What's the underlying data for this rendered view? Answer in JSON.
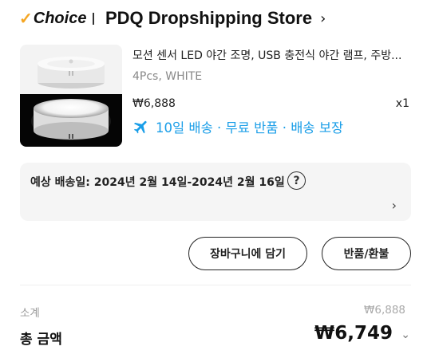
{
  "header": {
    "choice_label": "Choice",
    "store_name": "PDQ Dropshipping Store",
    "chevron": "›"
  },
  "product": {
    "image_alt": "motion sensor night light",
    "title": "모션 센서 LED 야간 조명, USB 충전식 야간 램프, 주방...",
    "variant": "4Pcs, WHITE",
    "price": "₩6,888",
    "quantity": "x1",
    "shipping_text": "10일 배송 · 무료 반품 · 배송 보장",
    "shipping_icon": "airplane-icon"
  },
  "delivery": {
    "estimate_text": "예상 배송일: 2024년 2월 14일-2024년 2월 16일",
    "help_icon": "?",
    "chevron": "›"
  },
  "actions": {
    "cart_label": "장바구니에 담기",
    "return_label": "반품/환불"
  },
  "summary": {
    "subtotal_label": "소계",
    "subtotal_value": "₩6,888",
    "total_label": "총 금액",
    "total_value": "₩6,749",
    "chevron": "⌄"
  },
  "colors": {
    "accent_blue": "#1a9ee8",
    "choice_check": "#f5a623"
  }
}
